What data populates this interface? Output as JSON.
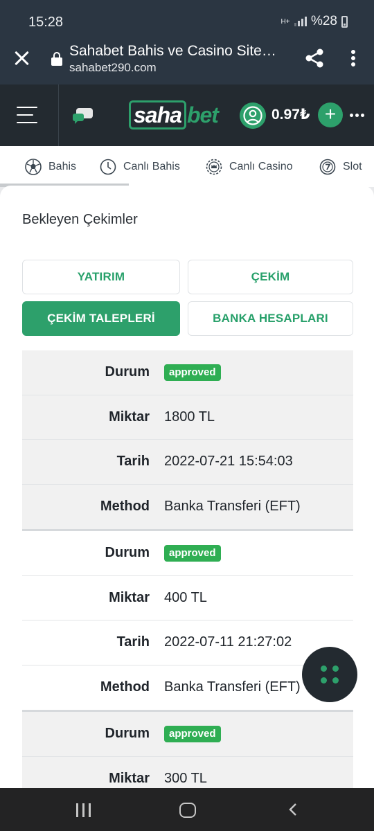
{
  "status_bar": {
    "time": "15:28",
    "network": "H+",
    "battery": "%28"
  },
  "browser": {
    "title": "Sahabet Bahis ve Casino Site…",
    "url": "sahabet290.com"
  },
  "header": {
    "logo_part1": "saha",
    "logo_part2": "bet",
    "balance": "0.97₺",
    "plus": "+"
  },
  "categories": [
    {
      "label": "Bahis",
      "icon": "soccer-ball-icon"
    },
    {
      "label": "Canlı Bahis",
      "icon": "clock-icon"
    },
    {
      "label": "Canlı Casino",
      "icon": "crown-chip-icon"
    },
    {
      "label": "Slot",
      "icon": "seven-chip-icon"
    }
  ],
  "page": {
    "title": "Bekleyen Çekimler",
    "tabs": [
      {
        "label": "YATIRIM",
        "active": false
      },
      {
        "label": "ÇEKİM",
        "active": false
      },
      {
        "label": "ÇEKİM TALEPLERİ",
        "active": true
      },
      {
        "label": "BANKA HESAPLARI",
        "active": false
      }
    ]
  },
  "labels": {
    "status": "Durum",
    "amount": "Miktar",
    "date": "Tarih",
    "method": "Method"
  },
  "records": [
    {
      "status": "approved",
      "amount": "1800 TL",
      "date": "2022-07-21 15:54:03",
      "method": "Banka Transferi (EFT)"
    },
    {
      "status": "approved",
      "amount": "400 TL",
      "date": "2022-07-11 21:27:02",
      "method": "Banka Transferi (EFT)"
    },
    {
      "status": "approved",
      "amount": "300 TL"
    }
  ],
  "colors": {
    "accent": "#2da06b",
    "badge": "#2fae53",
    "header_bg": "#232a30",
    "browser_bg": "#2b3642"
  }
}
